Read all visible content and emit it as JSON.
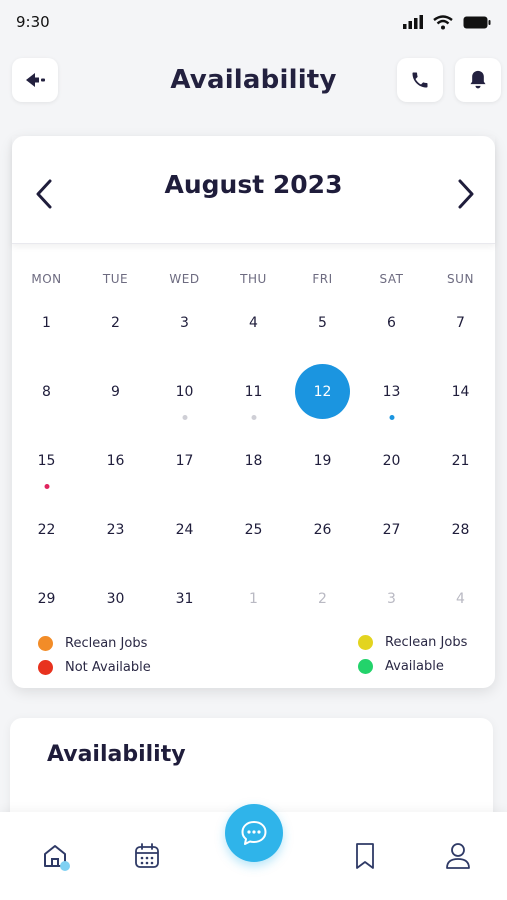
{
  "status": {
    "time": "9:30"
  },
  "header": {
    "title": "Availability"
  },
  "calendar": {
    "month_label": "August 2023",
    "weekdays": [
      "MON",
      "TUE",
      "WED",
      "THU",
      "FRI",
      "SAT",
      "SUN"
    ],
    "days": [
      {
        "n": "1"
      },
      {
        "n": "2"
      },
      {
        "n": "3"
      },
      {
        "n": "4"
      },
      {
        "n": "5"
      },
      {
        "n": "6"
      },
      {
        "n": "7"
      },
      {
        "n": "8"
      },
      {
        "n": "9"
      },
      {
        "n": "10",
        "dot": "#cfcfd6"
      },
      {
        "n": "11",
        "dot": "#cfcfd6"
      },
      {
        "n": "12",
        "selected": true
      },
      {
        "n": "13",
        "dot": "#1b95e0"
      },
      {
        "n": "14"
      },
      {
        "n": "15",
        "dot": "#e0245e"
      },
      {
        "n": "16"
      },
      {
        "n": "17"
      },
      {
        "n": "18"
      },
      {
        "n": "19"
      },
      {
        "n": "20"
      },
      {
        "n": "21"
      },
      {
        "n": "22"
      },
      {
        "n": "23"
      },
      {
        "n": "24"
      },
      {
        "n": "25"
      },
      {
        "n": "26"
      },
      {
        "n": "27"
      },
      {
        "n": "28"
      },
      {
        "n": "29"
      },
      {
        "n": "30"
      },
      {
        "n": "31"
      },
      {
        "n": "1",
        "muted": true
      },
      {
        "n": "2",
        "muted": true
      },
      {
        "n": "3",
        "muted": true
      },
      {
        "n": "4",
        "muted": true
      }
    ],
    "legend": [
      {
        "label": "Reclean Jobs",
        "color": "#f28c28"
      },
      {
        "label": "Not Available",
        "color": "#e8321e"
      },
      {
        "label": "Reclean Jobs",
        "color": "#e3d41f"
      },
      {
        "label": "Available",
        "color": "#23d36b"
      }
    ]
  },
  "availability_section": {
    "title": "Availability"
  },
  "colors": {
    "accent": "#1b95e0",
    "fab": "#2fb4ea",
    "text": "#1f1d3b"
  },
  "bottom_nav": {
    "items": [
      "home-icon",
      "calendar-icon",
      "chat-icon",
      "bookmark-icon",
      "profile-icon"
    ],
    "active": "home-icon"
  }
}
